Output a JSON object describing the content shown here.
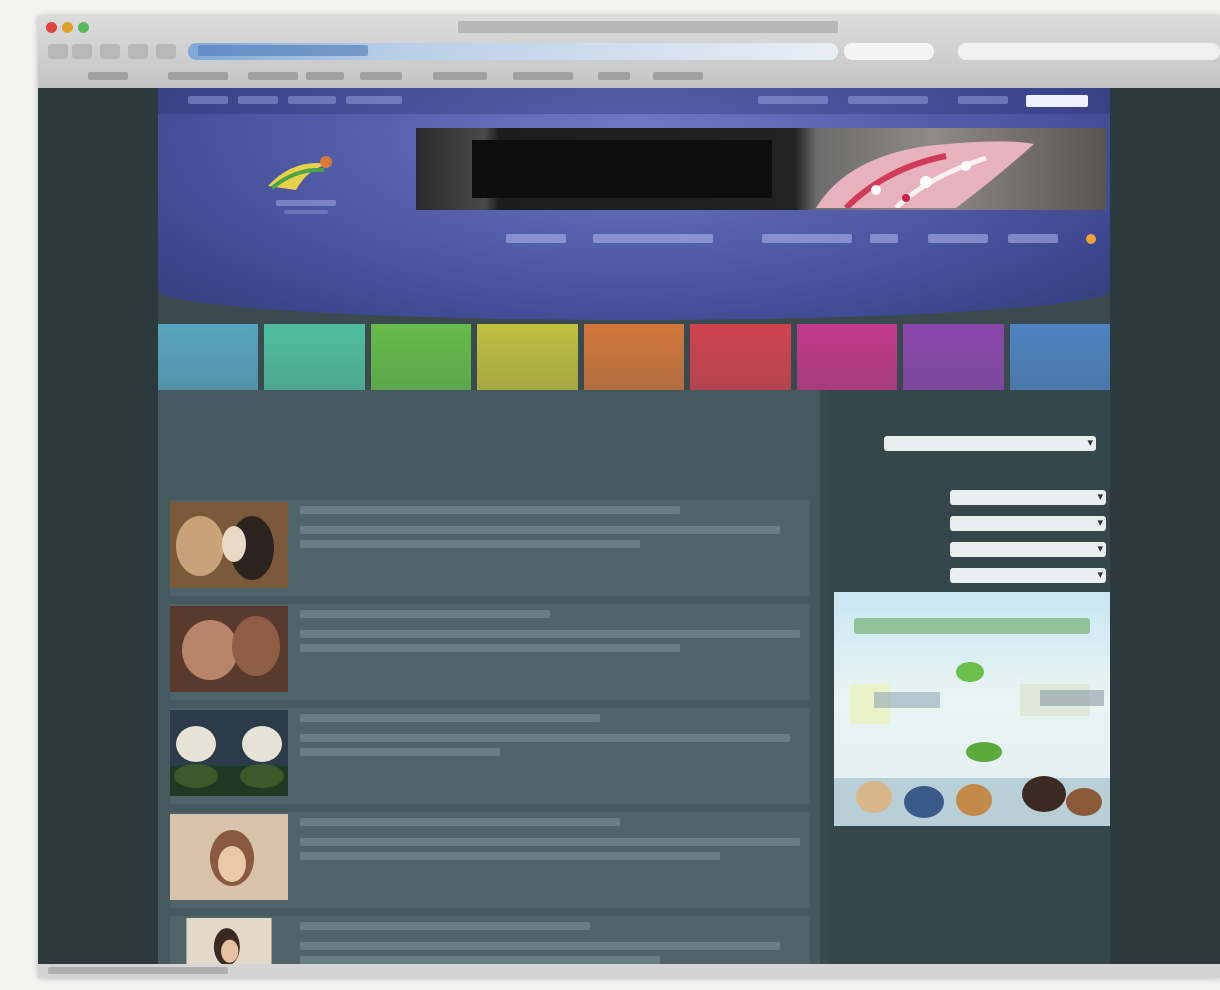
{
  "browser": {
    "window_title": "",
    "address_url": "",
    "search_placeholder": ""
  },
  "site": {
    "tabs": [
      {
        "label": "",
        "color": "#5aa9c6"
      },
      {
        "label": "",
        "color": "#52c4a4"
      },
      {
        "label": "",
        "color": "#68c24a"
      },
      {
        "label": "",
        "color": "#c7c640"
      },
      {
        "label": "",
        "color": "#d8793a"
      },
      {
        "label": "",
        "color": "#d8434f"
      },
      {
        "label": "",
        "color": "#c8388e"
      },
      {
        "label": "",
        "color": "#8f47b2"
      },
      {
        "label": "",
        "color": "#4f86c6"
      }
    ],
    "accent_orange": "#f3a23a",
    "more_link_color": "#c6b243"
  },
  "main": {
    "title": "",
    "subtitle": "",
    "list_head_left": "",
    "list_head_right": "",
    "articles": [
      {
        "title": "",
        "more": ""
      },
      {
        "title": "",
        "more": ""
      },
      {
        "title": "",
        "more": ""
      },
      {
        "title": "",
        "more": ""
      },
      {
        "title": "",
        "more": ""
      }
    ]
  },
  "sidebar": {
    "heading": "",
    "filters": [
      {
        "label": "",
        "value": ""
      },
      {
        "label": "",
        "value": ""
      },
      {
        "label": "",
        "value": ""
      },
      {
        "label": "",
        "value": ""
      }
    ],
    "ad_title": ""
  }
}
